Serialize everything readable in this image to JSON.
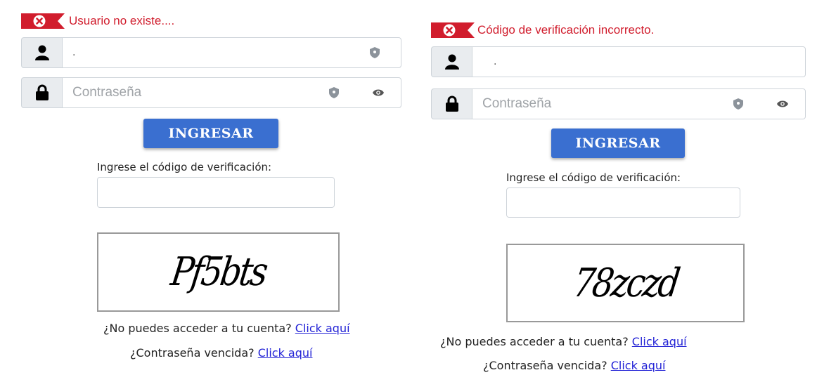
{
  "colors": {
    "error": "#d11d2d",
    "primary_button": "#3a6fd0",
    "link": "#2323d6"
  },
  "left": {
    "error_message": "Usuario no existe....",
    "username_value": ".",
    "password_placeholder": "Contraseña",
    "submit_label": "INGRESAR",
    "code_label": "Ingrese el código de verificación:",
    "code_value": "",
    "captcha_text": "Pf5bts",
    "help": [
      {
        "text": "¿No puedes acceder a tu cuenta?",
        "link": "Click aquí"
      },
      {
        "text": "¿Contraseña vencida?",
        "link": "Click aquí"
      }
    ]
  },
  "right": {
    "error_message": "Código de verificación incorrecto.",
    "username_value": ".",
    "password_placeholder": "Contraseña",
    "submit_label": "INGRESAR",
    "code_label": "Ingrese el código de verificación:",
    "code_value": "",
    "captcha_text": "78zczd",
    "help": [
      {
        "text": "¿No puedes acceder a tu cuenta?",
        "link": "Click aquí"
      },
      {
        "text": "¿Contraseña vencida?",
        "link": "Click aquí"
      }
    ]
  },
  "icons": {
    "error": "error-x-icon",
    "user": "user-icon",
    "lock": "lock-icon",
    "shield": "shield-icon",
    "eye": "eye-icon"
  }
}
